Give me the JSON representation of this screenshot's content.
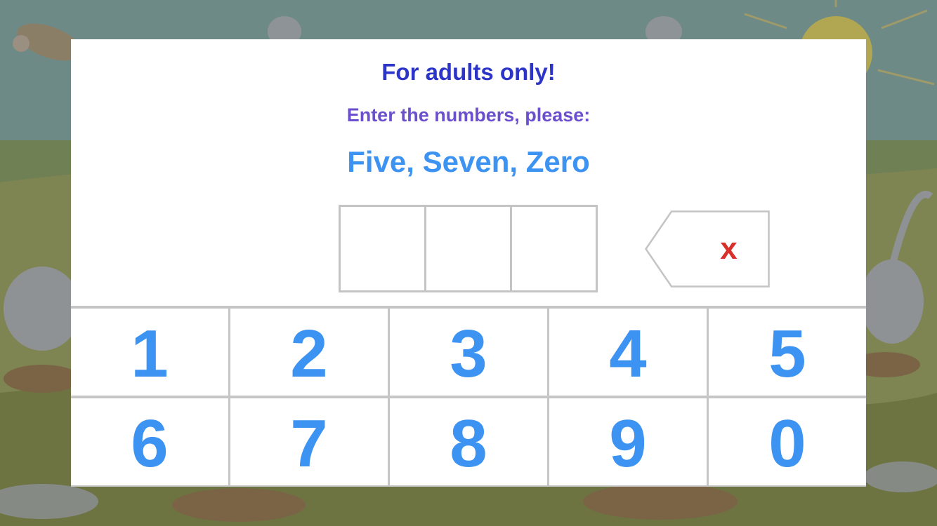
{
  "dialog": {
    "title": "For adults only!",
    "subtitle": "Enter the numbers, please:",
    "challenge": "Five, Seven, Zero",
    "code_slots": [
      "",
      "",
      ""
    ],
    "clear_label": "x"
  },
  "keypad": {
    "keys": [
      "1",
      "2",
      "3",
      "4",
      "5",
      "6",
      "7",
      "8",
      "9",
      "0"
    ]
  },
  "colors": {
    "title": "#2c35c8",
    "subtitle": "#6b4fcc",
    "challenge": "#3d93f2",
    "keys": "#3d93f2",
    "clear": "#d8302a",
    "border": "#c4c4c4"
  },
  "icons": {
    "clear": "backspace-x-icon"
  }
}
